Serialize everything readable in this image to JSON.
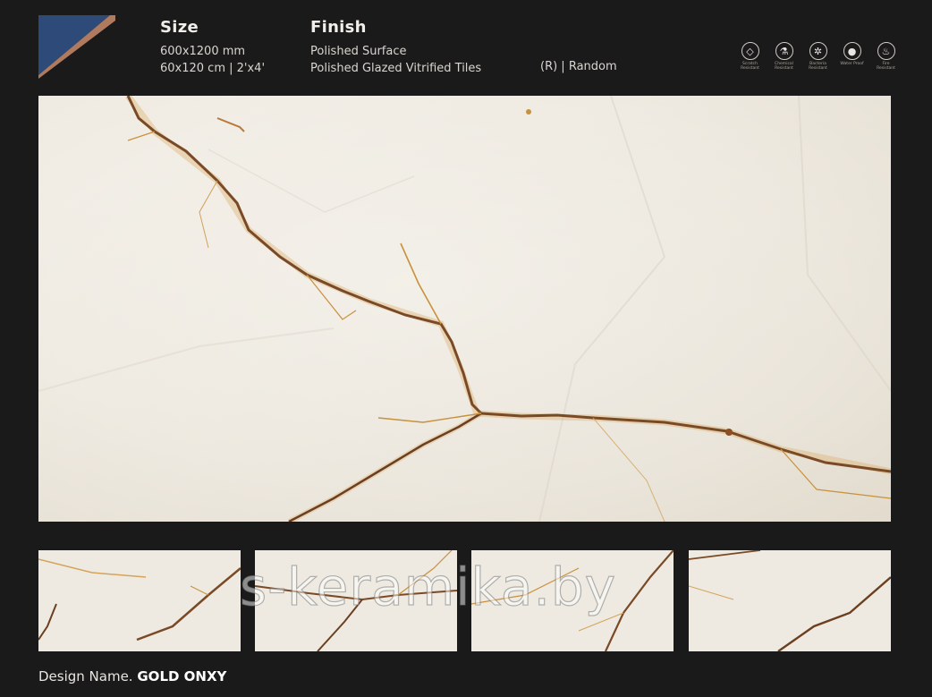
{
  "header": {
    "size": {
      "heading": "Size",
      "lines": [
        "600x1200 mm",
        "60x120 cm | 2'x4'"
      ]
    },
    "finish": {
      "heading": "Finish",
      "lines": [
        "Polished Surface",
        "Polished Glazed Vitrified Tiles"
      ]
    },
    "variation": "(R) | Random"
  },
  "features": [
    {
      "icon": "diamond-icon",
      "glyph": "◇",
      "label": "Scratch Resistant"
    },
    {
      "icon": "flask-icon",
      "glyph": "⚗",
      "label": "Chemical Resistant"
    },
    {
      "icon": "bacteria-icon",
      "glyph": "✲",
      "label": "Bacteria Resistant"
    },
    {
      "icon": "water-drop-icon",
      "glyph": "●",
      "label": "Water Proof"
    },
    {
      "icon": "fire-icon",
      "glyph": "♨",
      "label": "Fire Resistant"
    }
  ],
  "watermark": "s-keramika.by",
  "design": {
    "label": "Design Name.",
    "name": "GOLD ONXY"
  },
  "colors": {
    "background": "#1b1a1a",
    "swatch_blue": "#2e4a78",
    "swatch_copper": "#b07a5e",
    "marble_base": "#efebe2",
    "vein_brown": "#7a4a26",
    "vein_gold": "#c8913c"
  }
}
